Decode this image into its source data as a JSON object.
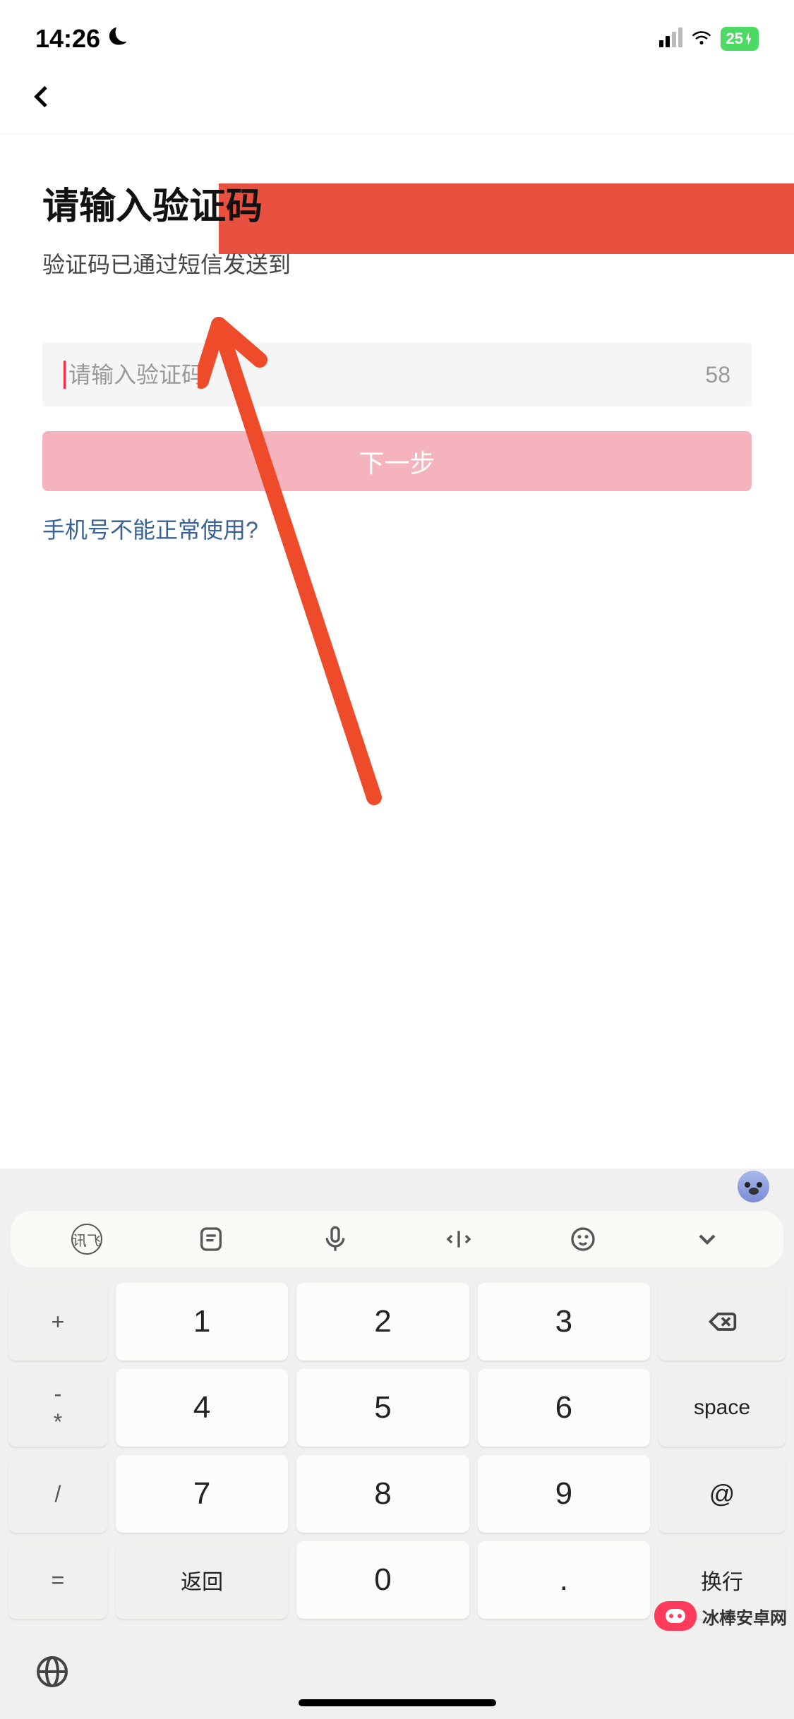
{
  "status": {
    "time": "14:26",
    "battery": "25"
  },
  "page": {
    "title": "请输入验证码",
    "subtitle": "验证码已通过短信发送到",
    "input_placeholder": "请输入验证码",
    "countdown": "58",
    "next_button": "下一步",
    "help_link": "手机号不能正常使用?"
  },
  "keyboard": {
    "toolbar": {
      "ime": "讯飞"
    },
    "left_syms": {
      "r1a": "+",
      "r1b": "",
      "r2a": "-",
      "r2b": "*",
      "r3a": "/",
      "r3b": "",
      "r4a": "=",
      "r4b": ""
    },
    "keys": {
      "k1": "1",
      "k2": "2",
      "k3": "3",
      "k4": "4",
      "k5": "5",
      "k6": "6",
      "k7": "7",
      "k8": "8",
      "k9": "9",
      "k0": "0",
      "back": "返回",
      "dot": ".",
      "space": "space",
      "at": "@",
      "enter": "换行"
    }
  },
  "watermark": {
    "text": "冰棒安卓网"
  }
}
